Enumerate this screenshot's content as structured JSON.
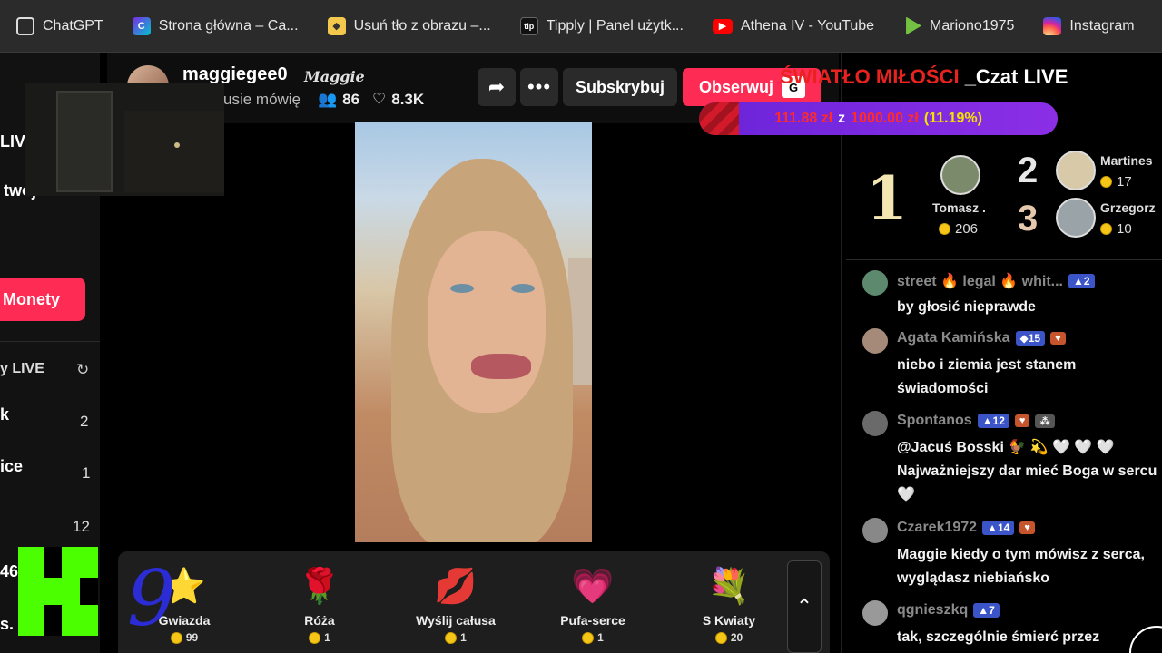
{
  "bookmarks": [
    {
      "label": "ChatGPT",
      "icon": "chatgpt-icon"
    },
    {
      "label": "Strona główna – Ca...",
      "icon": "canva-icon"
    },
    {
      "label": "Usuń tło z obrazu –...",
      "icon": "remove-bg-icon"
    },
    {
      "label": "Tipply | Panel użytk...",
      "icon": "tipply-icon"
    },
    {
      "label": "Athena IV - YouTube",
      "icon": "youtube-icon"
    },
    {
      "label": "Mariono1975",
      "icon": "rumble-icon"
    },
    {
      "label": "Instagram",
      "icon": "instagram-icon"
    }
  ],
  "sidebar": {
    "partial_live": "LIVE",
    "partial_twoj": "twoj",
    "monety_label": "Monety",
    "live_section": "y LIVE",
    "rows": [
      {
        "name": "k",
        "count": "2"
      },
      {
        "name": "ice",
        "count": "1"
      },
      {
        "name": "",
        "count": "12"
      }
    ],
    "bottom_a": "46",
    "bottom_b": "s."
  },
  "stream": {
    "streamer_handle": "maggiegee0",
    "streamer_nick": "Maggie",
    "subtitle": "usie mówię",
    "viewers": "86",
    "likes": "8.3K",
    "subscribe_label": "Subskrybuj",
    "follow_label": "Obserwuj",
    "badge": "G"
  },
  "gifts": [
    {
      "name": "Gwiazda",
      "price": "99",
      "emoji": "⭐"
    },
    {
      "name": "Róża",
      "price": "1",
      "emoji": "🌹"
    },
    {
      "name": "Wyślij całusa",
      "price": "1",
      "emoji": "💋"
    },
    {
      "name": "Pufa-serce",
      "price": "1",
      "emoji": "💗"
    },
    {
      "name": "S Kwiaty",
      "price": "20",
      "emoji": "💐"
    }
  ],
  "overlay": {
    "nine": "9",
    "chat_title_red": "ŚWIATŁO MIŁOŚCI ",
    "chat_title_white": "_Czat LIVE",
    "goal_current": "111.88 zł",
    "goal_of": "z",
    "goal_target": "1000.00 zł",
    "goal_percent": "(11.19%)",
    "goal_fraction": 0.1119
  },
  "ranking": {
    "first_label": "1",
    "second_label": "2",
    "third_label": "3",
    "first": {
      "name": "Tomasz .",
      "points": "206"
    },
    "second": {
      "name": "Martines",
      "points": "17"
    },
    "third": {
      "name": "Grzegorz",
      "points": "10"
    }
  },
  "chat": [
    {
      "user": "street 🔥 legal 🔥 whit...",
      "badges": [
        "▲2"
      ],
      "text": "by głosić nieprawde"
    },
    {
      "user": "Agata Kamińska",
      "badges": [
        "◆15",
        "♥"
      ],
      "text": "niebo i ziemia jest stanem świadomości"
    },
    {
      "user": "Spontanos",
      "badges": [
        "▲12",
        "♥",
        "⁂"
      ],
      "text": "@Jacuś Bosski 🐓 💫 🤍 🤍 🤍 Najważniejszy dar mieć Boga w sercu 🤍"
    },
    {
      "user": "Czarek1972",
      "badges": [
        "▲14",
        "♥"
      ],
      "text": "Maggie kiedy o tym mówisz z serca, wyglądasz niebiańsko"
    },
    {
      "user": "qgnieszkq",
      "badges": [
        "▲7"
      ],
      "text": "tak, szczególnie śmierć przez"
    }
  ],
  "colors": {
    "accent": "#fe2c55",
    "title_red": "#e8221f",
    "k_logo": "#4cff00"
  }
}
